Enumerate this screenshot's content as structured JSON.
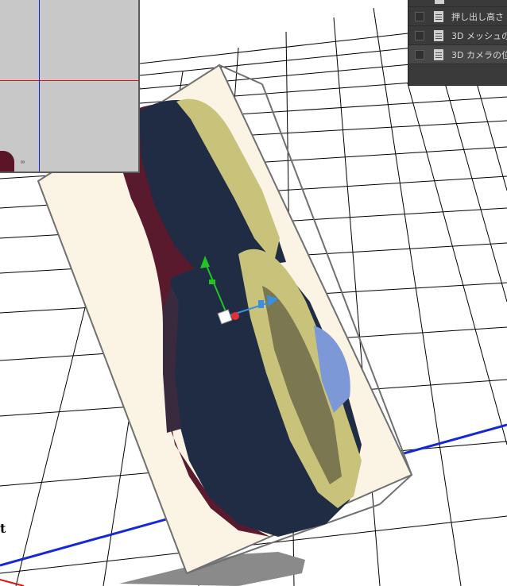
{
  "viewport": {
    "description_name": "3d-viewport"
  },
  "secondary_view": {
    "label": "8"
  },
  "layers_panel": {
    "items": [
      {
        "label": "押し出し高さ"
      },
      {
        "label": "3D メッシュの位"
      },
      {
        "label": "3D カメラの位"
      }
    ]
  },
  "viewport_glyph": "t",
  "colors": {
    "grid_line": "#000000",
    "axis_x": "#e01010",
    "axis_z": "#1428d8",
    "object_front": "#1f2c44",
    "object_side": "#5a1a2e",
    "object_face": "#c8c27a",
    "bounding_box_fill": "#fbf3e3",
    "gizmo_y": "#22c422",
    "gizmo_z": "#3a8fe0",
    "gizmo_x": "#e03030"
  }
}
